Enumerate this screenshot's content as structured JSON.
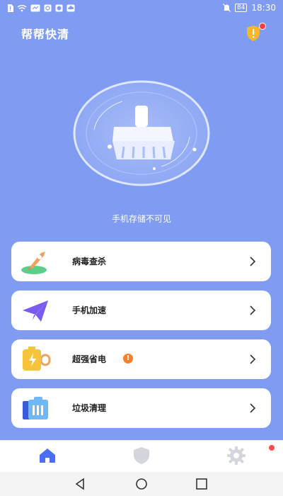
{
  "status_bar": {
    "time": "18:30",
    "battery": "84",
    "left_icons": [
      "sim-alert-icon",
      "wifi-icon",
      "app-icon",
      "app-icon",
      "app-icon",
      "cloud-icon"
    ],
    "right_icons": [
      "mute-icon",
      "battery-icon"
    ]
  },
  "header": {
    "title": "帮帮快清",
    "alert_icon": "shield-alert-icon"
  },
  "cleaner": {
    "icon": "broom-icon",
    "storage_text": "手机存储不可见"
  },
  "cards": [
    {
      "label": "病毒查杀",
      "icon": "rocket-icon",
      "badge": ""
    },
    {
      "label": "手机加速",
      "icon": "paper-plane-icon",
      "badge": ""
    },
    {
      "label": "超强省电",
      "icon": "battery-icon",
      "badge": "!"
    },
    {
      "label": "垃圾清理",
      "icon": "trash-folder-icon",
      "badge": ""
    }
  ],
  "bottom_nav": {
    "items": [
      "home-icon",
      "shield-icon",
      "gear-icon"
    ],
    "active_index": 0
  },
  "colors": {
    "background": "#7f9cf2",
    "accent": "#4a6ef5",
    "badge": "#f5802c"
  }
}
